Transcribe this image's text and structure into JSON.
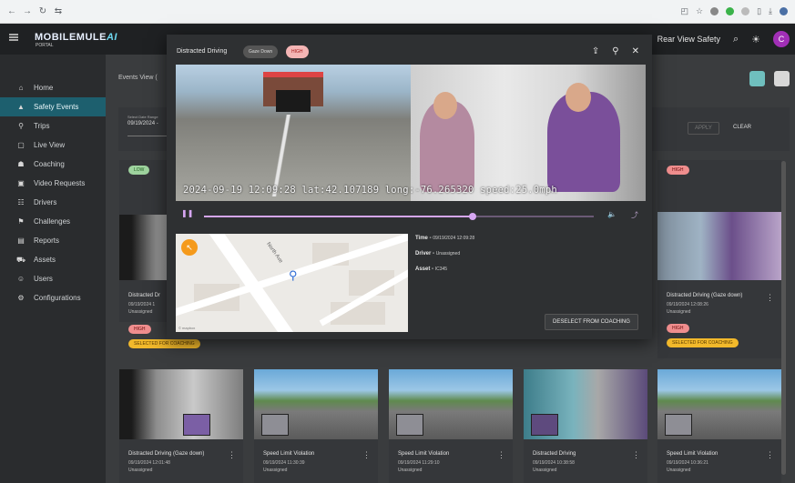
{
  "browser": {
    "nav": [
      "←",
      "→",
      "↻",
      "⇆"
    ],
    "right_icons": [
      "◰",
      "☆",
      "●",
      "●",
      "●",
      "▯",
      "⤓",
      "●"
    ]
  },
  "header": {
    "logo": "MOBILEMULE",
    "logo_ai": "AI",
    "logo_sub": "PORTAL",
    "title": "Rear View Safety",
    "search_icon": "⌕",
    "brightness_icon": "☀",
    "avatar_letter": "C"
  },
  "sidebar": {
    "items": [
      {
        "icon": "⌂",
        "label": "Home"
      },
      {
        "icon": "▲",
        "label": "Safety Events"
      },
      {
        "icon": "⚲",
        "label": "Trips"
      },
      {
        "icon": "▢",
        "label": "Live View"
      },
      {
        "icon": "☗",
        "label": "Coaching"
      },
      {
        "icon": "▣",
        "label": "Video Requests"
      },
      {
        "icon": "☷",
        "label": "Drivers"
      },
      {
        "icon": "⚑",
        "label": "Challenges"
      },
      {
        "icon": "▤",
        "label": "Reports"
      },
      {
        "icon": "⛟",
        "label": "Assets"
      },
      {
        "icon": "☺",
        "label": "Users"
      },
      {
        "icon": "⚙",
        "label": "Configurations"
      }
    ]
  },
  "main": {
    "events_view": "Events View (",
    "filter": {
      "date_label": "Select Date Range",
      "date_value": "09/19/2024 -",
      "apply": "APPLY",
      "clear": "CLEAR"
    }
  },
  "cards_row1": [
    {
      "badge": "LOW",
      "title": "Distracted Dr",
      "date": "09/19/2024 1",
      "driver": "Unassigned",
      "chip": "HIGH",
      "coach": "SELECTED FOR COACHING"
    },
    {
      "badge": "HIGH",
      "title": "Distracted Driving (Gaze down)",
      "date": "09/19/2024 12:08:26",
      "driver": "Unassigned",
      "chip": "HIGH",
      "coach": "SELECTED FOR COACHING"
    }
  ],
  "cards_row2": [
    {
      "title": "Distracted Driving (Gaze down)",
      "date": "09/19/2024 12:01:48",
      "driver": "Unassigned"
    },
    {
      "title": "Speed Limit Violation",
      "date": "09/19/2024 11:30:39",
      "driver": "Unassigned"
    },
    {
      "title": "Speed Limit Violation",
      "date": "09/19/2024 11:29:10",
      "driver": "Unassigned"
    },
    {
      "title": "Distracted Driving",
      "date": "09/19/2024 10:38:58",
      "driver": "Unassigned"
    },
    {
      "title": "Speed Limit Violation",
      "date": "09/19/2024 10:36:21",
      "driver": "Unassigned"
    }
  ],
  "modal": {
    "title": "Distracted Driving",
    "tag_gaze": "Gaze Down",
    "tag_high": "HIGH",
    "osd": "2024-09-19 12:09:28 lat:42.107189 long:-76.265320 speed:25.0mph",
    "progress": 0.69,
    "map_street": "North Ave",
    "map_attribution": "© mapbox",
    "details": {
      "time_label": "Time - ",
      "time_value": "09/19/2024 12:09:28",
      "driver_label": "Driver - ",
      "driver_value": "Unassigned",
      "asset_label": "Asset - ",
      "asset_value": "IC345"
    },
    "deselect": "DESELECT FROM COACHING",
    "icons": {
      "share": "⇪",
      "pin": "⚲",
      "close": "✕",
      "play": "❚❚",
      "volume": "🔈",
      "chart": "⤴"
    }
  }
}
